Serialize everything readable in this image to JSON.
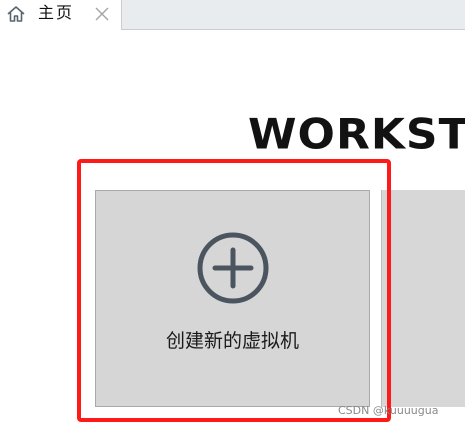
{
  "tab": {
    "label": "主页",
    "home_icon": "home-icon",
    "close_icon": "close-icon"
  },
  "brand": {
    "text": "WORKST"
  },
  "create_card": {
    "label": "创建新的虚拟机",
    "icon": "plus-circle-icon"
  },
  "watermark": {
    "text": "CSDN @kuuuugua"
  },
  "colors": {
    "highlight": "#ff1a1a",
    "card_bg": "#d6d6d6",
    "icon": "#4a5560"
  }
}
